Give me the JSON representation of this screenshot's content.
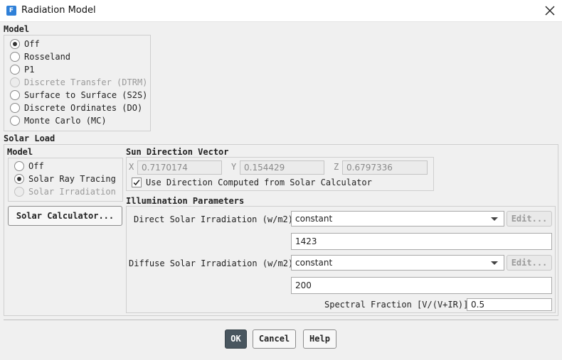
{
  "window": {
    "title": "Radiation Model",
    "app_icon_letter": "F"
  },
  "model": {
    "label": "Model",
    "options": [
      {
        "label": "Off",
        "selected": true,
        "disabled": false
      },
      {
        "label": "Rosseland",
        "selected": false,
        "disabled": false
      },
      {
        "label": "P1",
        "selected": false,
        "disabled": false
      },
      {
        "label": "Discrete Transfer (DTRM)",
        "selected": false,
        "disabled": true
      },
      {
        "label": "Surface to Surface (S2S)",
        "selected": false,
        "disabled": false
      },
      {
        "label": "Discrete Ordinates (DO)",
        "selected": false,
        "disabled": false
      },
      {
        "label": "Monte Carlo (MC)",
        "selected": false,
        "disabled": false
      }
    ]
  },
  "solar_load": {
    "label": "Solar Load",
    "model": {
      "label": "Model",
      "options": [
        {
          "label": "Off",
          "selected": false,
          "disabled": false
        },
        {
          "label": "Solar Ray Tracing",
          "selected": true,
          "disabled": false
        },
        {
          "label": "Solar Irradiation",
          "selected": false,
          "disabled": true
        }
      ]
    },
    "solar_calculator_button": "Solar Calculator...",
    "sun_direction": {
      "label": "Sun Direction Vector",
      "x_label": "X",
      "x_value": "0.7170174",
      "y_label": "Y",
      "y_value": "0.154429",
      "z_label": "Z",
      "z_value": "0.6797336",
      "use_calculator_label": "Use Direction Computed from Solar Calculator",
      "use_calculator_checked": true
    },
    "illumination": {
      "label": "Illumination Parameters",
      "direct_label": "Direct Solar Irradiation (w/m2)",
      "direct_method": "constant",
      "direct_value": "1423",
      "diffuse_label": "Diffuse Solar Irradiation (w/m2)",
      "diffuse_method": "constant",
      "diffuse_value": "200",
      "edit_label": "Edit...",
      "spectral_label": "Spectral Fraction [V/(V+IR)]",
      "spectral_value": "0.5"
    }
  },
  "footer": {
    "ok_label": "OK",
    "cancel_label": "Cancel",
    "help_label": "Help"
  }
}
